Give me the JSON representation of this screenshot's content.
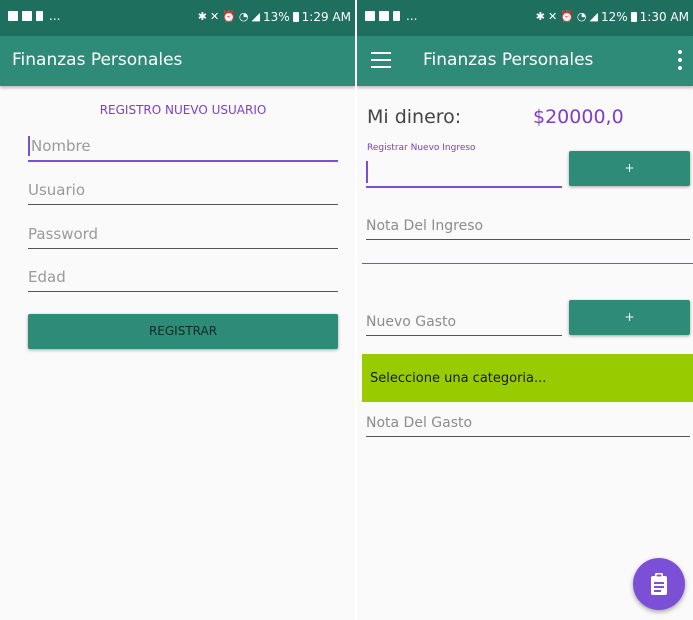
{
  "status_left": {
    "time": "1:29 AM",
    "battery": "13%",
    "dots": "..."
  },
  "status_right": {
    "time": "1:30 AM",
    "battery": "12%",
    "dots": "..."
  },
  "left_screen": {
    "app_title": "Finanzas Personales",
    "register_title": "REGISTRO NUEVO USUARIO",
    "fields": {
      "nombre_placeholder": "Nombre",
      "usuario_placeholder": "Usuario",
      "password_placeholder": "Password",
      "edad_placeholder": "Edad"
    },
    "register_button": "REGISTRAR"
  },
  "right_screen": {
    "app_title": "Finanzas Personales",
    "money_label": "Mi dinero:",
    "money_value": "$20000,0",
    "income_label": "Registrar Nuevo Ingreso",
    "income_add_button": "+",
    "income_note_placeholder": "Nota Del Ingreso",
    "expense_placeholder": "Nuevo Gasto",
    "expense_add_button": "+",
    "category_spinner": "Seleccione una categoria...",
    "expense_note_placeholder": "Nota Del Gasto"
  },
  "colors": {
    "status_bar": "#1f6f5e",
    "app_bar": "#2e8b78",
    "accent_purple": "#7b4fd6",
    "spinner_green": "#99cc00"
  },
  "icons": {
    "menu": "hamburger-menu-icon",
    "overflow": "overflow-menu-icon",
    "fab": "clipboard-icon"
  }
}
